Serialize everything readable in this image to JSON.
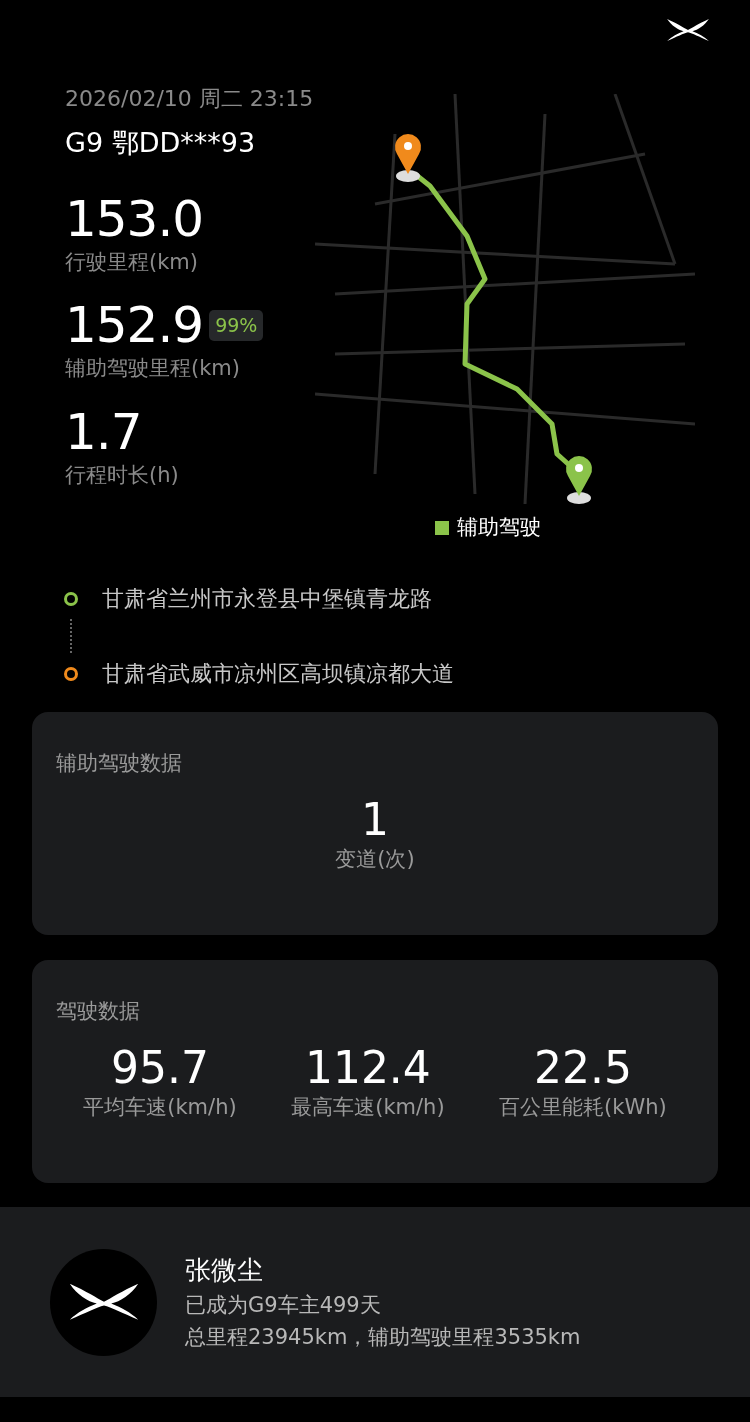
{
  "header": {
    "datetime": "2026/02/10 周二 23:15",
    "vehicle": "G9 鄂DD***93"
  },
  "stats": [
    {
      "value": "153.0",
      "label": "行驶里程(km)"
    },
    {
      "value": "152.9",
      "label": "辅助驾驶里程(km)",
      "badge": "99%"
    },
    {
      "value": "1.7",
      "label": "行程时长(h)"
    }
  ],
  "map": {
    "legend": "辅助驾驶"
  },
  "route": [
    {
      "place": "甘肃省兰州市永登县中堡镇青龙路",
      "color": "#8bc34a"
    },
    {
      "place": "甘肃省武威市凉州区高坝镇凉都大道",
      "color": "#f08a1c"
    }
  ],
  "assist_card": {
    "title": "辅助驾驶数据",
    "metrics": [
      {
        "value": "1",
        "label": "变道(次)"
      }
    ]
  },
  "driving_card": {
    "title": "驾驶数据",
    "metrics": [
      {
        "value": "95.7",
        "label": "平均车速(km/h)"
      },
      {
        "value": "112.4",
        "label": "最高车速(km/h)"
      },
      {
        "value": "22.5",
        "label": "百公里能耗(kWh)"
      }
    ]
  },
  "owner": {
    "name": "张微尘",
    "line1": "已成为G9车主499天",
    "line2": "总里程23945km，辅助驾驶里程3535km"
  }
}
